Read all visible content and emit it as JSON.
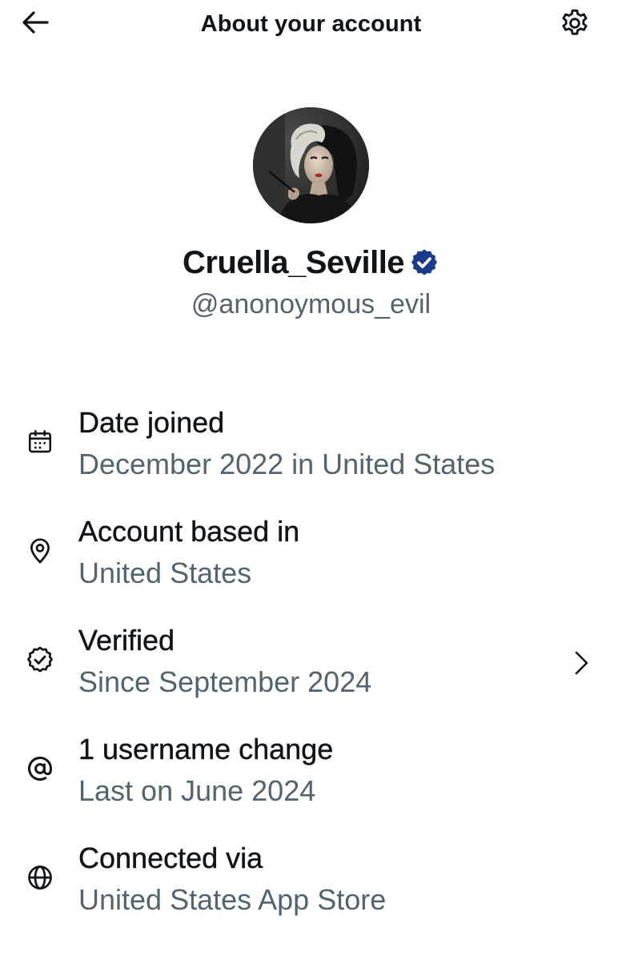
{
  "header": {
    "title": "About your account",
    "back_icon": "arrow-left-icon",
    "settings_icon": "gear-icon"
  },
  "profile": {
    "display_name": "Cruella_Seville",
    "handle": "@anonoymous_evil",
    "verified": true,
    "badge_color": "#1d9bf0",
    "badge_dark_color": "#1a3a8a"
  },
  "info": [
    {
      "icon": "calendar-icon",
      "title": "Date joined",
      "subtitle": "December 2022 in United States"
    },
    {
      "icon": "location-pin-icon",
      "title": "Account based in",
      "subtitle": "United States"
    },
    {
      "icon": "verified-check-icon",
      "title": "Verified",
      "subtitle": "Since September 2024",
      "has_chevron": true
    },
    {
      "icon": "at-sign-icon",
      "title": "1 username change",
      "subtitle": "Last on June 2024"
    },
    {
      "icon": "globe-icon",
      "title": "Connected via",
      "subtitle": "United States App Store"
    }
  ],
  "colors": {
    "text_primary": "#0f1419",
    "text_secondary": "#536471",
    "background": "#ffffff"
  }
}
